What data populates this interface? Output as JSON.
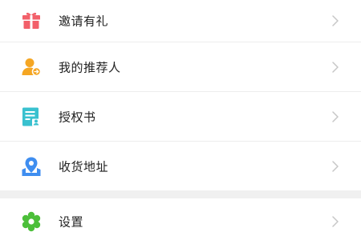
{
  "menu": {
    "group1": [
      {
        "label": "邀请有礼",
        "icon": "gift-icon",
        "color": "#f2606a"
      },
      {
        "label": "我的推荐人",
        "icon": "referrer-user-icon",
        "color": "#f5a623"
      },
      {
        "label": "授权书",
        "icon": "certificate-icon",
        "color": "#39c1cf"
      },
      {
        "label": "收货地址",
        "icon": "location-pin-icon",
        "color": "#3f8ef0"
      }
    ],
    "group2": [
      {
        "label": "设置",
        "icon": "gear-icon",
        "color": "#4cbf3a"
      }
    ]
  },
  "chevron_icon": "chevron-right-icon",
  "colors": {
    "divider": "#ededed",
    "section_gap": "#f0f0f0",
    "chevron": "#c7c7c7",
    "text": "#222222"
  }
}
